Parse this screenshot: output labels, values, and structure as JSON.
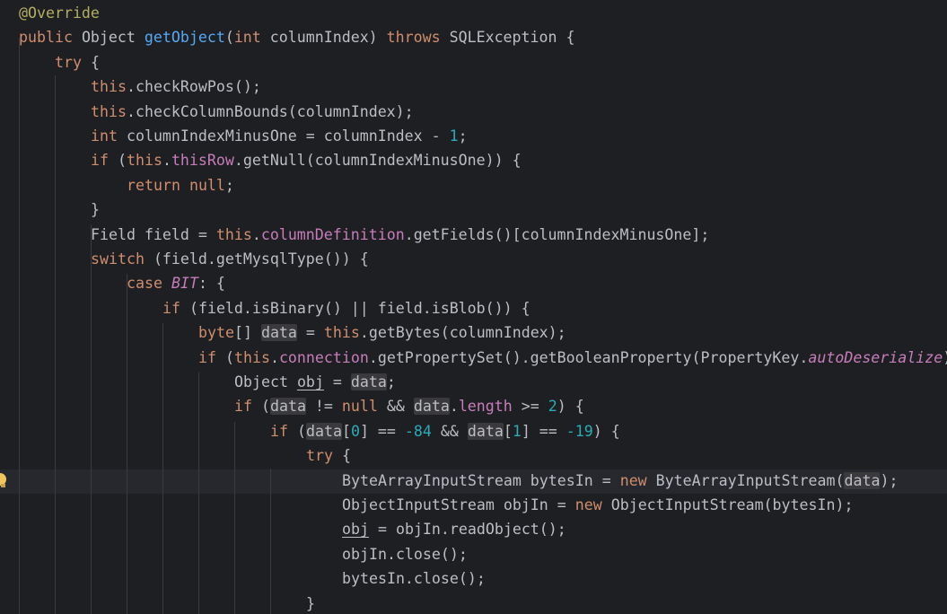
{
  "editor": {
    "colors": {
      "background": "#1e1f22",
      "current_line": "#26282e",
      "keyword": "#cf8e6d",
      "annotation": "#b3ae60",
      "method_declaration": "#56a8f5",
      "number": "#2aacb8",
      "field": "#c77dbb",
      "plain": "#bcbec4"
    },
    "gutter_icon": "intention-bulb-icon",
    "lines": [
      {
        "indent": 0,
        "tokens": [
          {
            "t": "@Override",
            "c": "ann"
          }
        ]
      },
      {
        "indent": 0,
        "tokens": [
          {
            "t": "public",
            "c": "kw"
          },
          {
            "t": " Object "
          },
          {
            "t": "getObject",
            "c": "fn"
          },
          {
            "t": "("
          },
          {
            "t": "int",
            "c": "kw"
          },
          {
            "t": " columnIndex) "
          },
          {
            "t": "throws",
            "c": "kw"
          },
          {
            "t": " SQLException {"
          }
        ]
      },
      {
        "indent": 1,
        "tokens": [
          {
            "t": "try",
            "c": "kw"
          },
          {
            "t": " {"
          }
        ]
      },
      {
        "indent": 2,
        "tokens": [
          {
            "t": "this",
            "c": "kw"
          },
          {
            "t": ".checkRowPos();"
          }
        ]
      },
      {
        "indent": 2,
        "tokens": [
          {
            "t": "this",
            "c": "kw"
          },
          {
            "t": ".checkColumnBounds(columnIndex);"
          }
        ]
      },
      {
        "indent": 2,
        "tokens": [
          {
            "t": "int",
            "c": "kw"
          },
          {
            "t": " columnIndexMinusOne = columnIndex - "
          },
          {
            "t": "1",
            "c": "num"
          },
          {
            "t": ";"
          }
        ]
      },
      {
        "indent": 2,
        "tokens": [
          {
            "t": "if",
            "c": "kw"
          },
          {
            "t": " ("
          },
          {
            "t": "this",
            "c": "kw"
          },
          {
            "t": "."
          },
          {
            "t": "thisRow",
            "c": "field"
          },
          {
            "t": ".getNull(columnIndexMinusOne)) {"
          }
        ]
      },
      {
        "indent": 3,
        "tokens": [
          {
            "t": "return",
            "c": "kw"
          },
          {
            "t": " "
          },
          {
            "t": "null",
            "c": "kw"
          },
          {
            "t": ";"
          }
        ]
      },
      {
        "indent": 2,
        "tokens": [
          {
            "t": "}"
          }
        ]
      },
      {
        "indent": 2,
        "tokens": [
          {
            "t": "Field field = "
          },
          {
            "t": "this",
            "c": "kw"
          },
          {
            "t": "."
          },
          {
            "t": "columnDefinition",
            "c": "field"
          },
          {
            "t": ".getFields()[columnIndexMinusOne];"
          }
        ]
      },
      {
        "indent": 2,
        "tokens": [
          {
            "t": "switch",
            "c": "kw"
          },
          {
            "t": " (field.getMysqlType()) {"
          }
        ]
      },
      {
        "indent": 3,
        "tokens": [
          {
            "t": "case",
            "c": "kw"
          },
          {
            "t": " "
          },
          {
            "t": "BIT",
            "c": "static"
          },
          {
            "t": ": {"
          }
        ]
      },
      {
        "indent": 4,
        "tokens": [
          {
            "t": "if",
            "c": "kw"
          },
          {
            "t": " (field.isBinary() || field.isBlob()) {"
          }
        ]
      },
      {
        "indent": 5,
        "tokens": [
          {
            "t": "byte",
            "c": "kw"
          },
          {
            "t": "[] "
          },
          {
            "t": "data",
            "c": "hl"
          },
          {
            "t": " = "
          },
          {
            "t": "this",
            "c": "kw"
          },
          {
            "t": ".getBytes(columnIndex);"
          }
        ]
      },
      {
        "indent": 5,
        "tokens": [
          {
            "t": "if",
            "c": "kw"
          },
          {
            "t": " ("
          },
          {
            "t": "this",
            "c": "kw"
          },
          {
            "t": "."
          },
          {
            "t": "connection",
            "c": "field"
          },
          {
            "t": ".getPropertySet().getBooleanProperty(PropertyKey."
          },
          {
            "t": "autoDeserialize",
            "c": "static"
          },
          {
            "t": ")"
          }
        ]
      },
      {
        "indent": 6,
        "tokens": [
          {
            "t": "Object "
          },
          {
            "t": "obj",
            "c": "ul"
          },
          {
            "t": " = "
          },
          {
            "t": "data",
            "c": "hl"
          },
          {
            "t": ";"
          }
        ]
      },
      {
        "indent": 6,
        "tokens": [
          {
            "t": "if",
            "c": "kw"
          },
          {
            "t": " ("
          },
          {
            "t": "data",
            "c": "hl"
          },
          {
            "t": " != "
          },
          {
            "t": "null",
            "c": "kw"
          },
          {
            "t": " && "
          },
          {
            "t": "data",
            "c": "hl"
          },
          {
            "t": "."
          },
          {
            "t": "length",
            "c": "field"
          },
          {
            "t": " >= "
          },
          {
            "t": "2",
            "c": "num"
          },
          {
            "t": ") {"
          }
        ]
      },
      {
        "indent": 7,
        "tokens": [
          {
            "t": "if",
            "c": "kw"
          },
          {
            "t": " ("
          },
          {
            "t": "data",
            "c": "hl"
          },
          {
            "t": "["
          },
          {
            "t": "0",
            "c": "num"
          },
          {
            "t": "] == "
          },
          {
            "t": "-84",
            "c": "num"
          },
          {
            "t": " && "
          },
          {
            "t": "data",
            "c": "hl"
          },
          {
            "t": "["
          },
          {
            "t": "1",
            "c": "num"
          },
          {
            "t": "] == "
          },
          {
            "t": "-19",
            "c": "num"
          },
          {
            "t": ") {"
          }
        ]
      },
      {
        "indent": 8,
        "tokens": [
          {
            "t": "try",
            "c": "kw"
          },
          {
            "t": " {"
          }
        ]
      },
      {
        "indent": 9,
        "tokens": [
          {
            "t": "ByteArrayInputStream bytesIn = "
          },
          {
            "t": "new",
            "c": "kw"
          },
          {
            "t": " ByteArrayInputStream("
          },
          {
            "t": "data",
            "c": "hl"
          },
          {
            "t": ");"
          }
        ]
      },
      {
        "indent": 9,
        "tokens": [
          {
            "t": "ObjectInputStream objIn = "
          },
          {
            "t": "new",
            "c": "kw"
          },
          {
            "t": " ObjectInputStream(bytesIn);"
          }
        ]
      },
      {
        "indent": 9,
        "tokens": [
          {
            "t": "obj",
            "c": "ul"
          },
          {
            "t": " = objIn.readObject();"
          }
        ]
      },
      {
        "indent": 9,
        "tokens": [
          {
            "t": "objIn.close();"
          }
        ]
      },
      {
        "indent": 9,
        "tokens": [
          {
            "t": "bytesIn.close();"
          }
        ]
      },
      {
        "indent": 8,
        "tokens": [
          {
            "t": "}"
          }
        ]
      }
    ]
  }
}
